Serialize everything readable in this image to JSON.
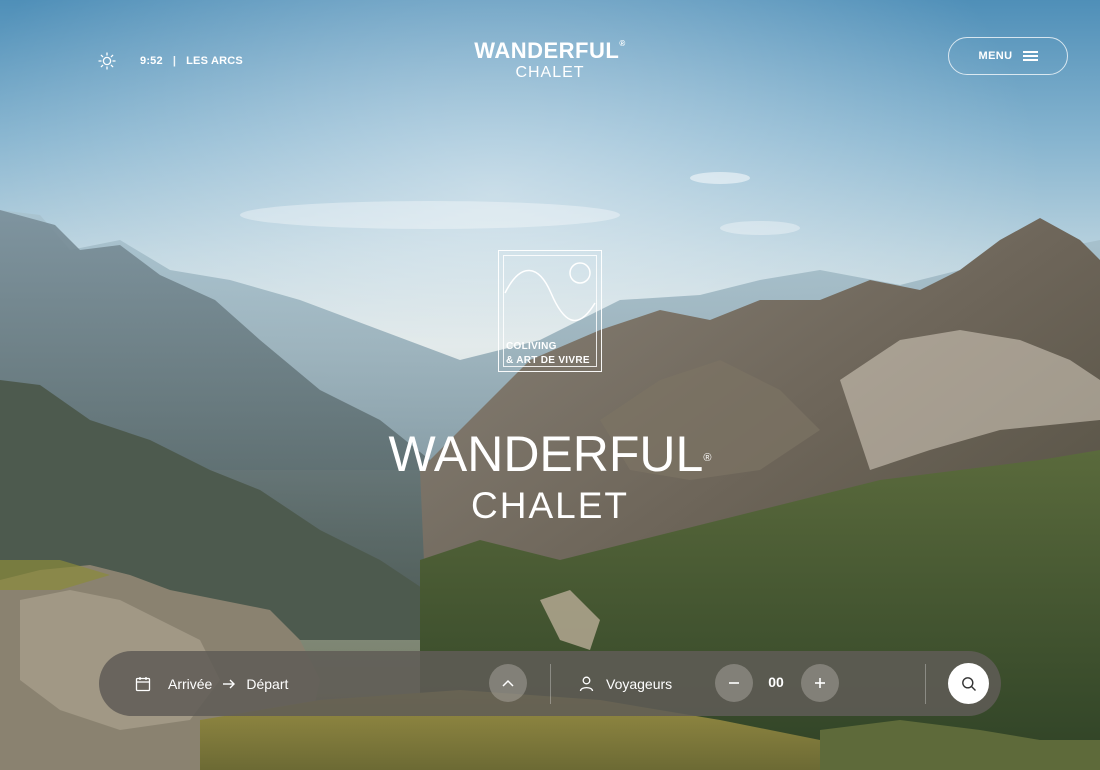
{
  "header": {
    "time": "9:52",
    "separator": "|",
    "location": "LES ARCS",
    "logo_line1": "WANDERFUL",
    "logo_registered": "®",
    "logo_line2": "CHALET",
    "menu_label": "MENU"
  },
  "emblem": {
    "line1": "COLIVING",
    "line2": "& ART DE VIVRE"
  },
  "hero": {
    "title_line1": "WANDERFUL",
    "title_registered": "®",
    "title_line2": "CHALET"
  },
  "booking": {
    "arrival_label": "Arrivée",
    "departure_label": "Départ",
    "guests_label": "Voyageurs",
    "guest_count": "00"
  },
  "icons": {
    "weather": "sun-icon",
    "menu": "hamburger-icon",
    "calendar": "calendar-icon",
    "arrow": "arrow-right-icon",
    "expand": "chevron-up-icon",
    "guests": "user-icon",
    "decrement": "minus-icon",
    "increment": "plus-icon",
    "search": "search-icon"
  },
  "colors": {
    "text": "#ffffff",
    "booking_bar": "#5f5c56",
    "search_button": "#ffffff",
    "sky_top": "#4f8fb8"
  }
}
